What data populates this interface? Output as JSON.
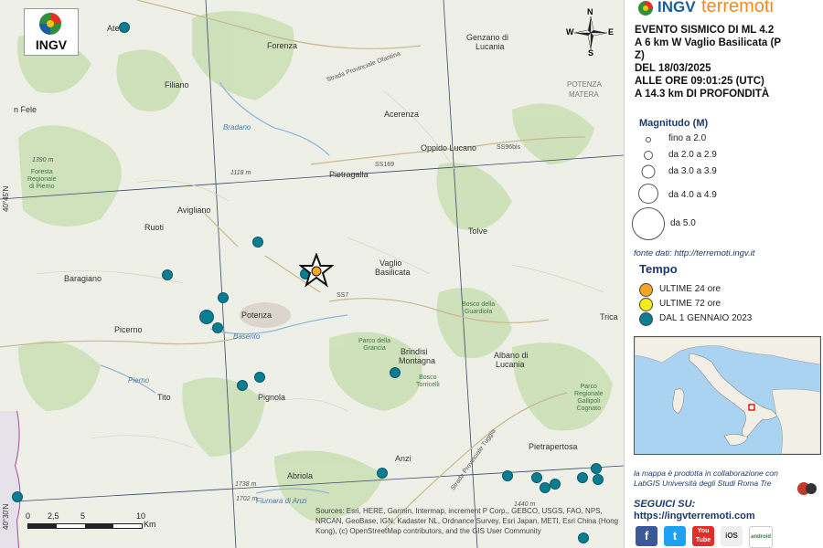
{
  "logo": {
    "label": "INGV"
  },
  "compass": {
    "n": "N",
    "s": "S",
    "e": "E",
    "w": "W"
  },
  "brand": {
    "prefix": "INGV",
    "suffix": "terremoti"
  },
  "event": {
    "line1": "EVENTO SISMICO DI ML 4.2",
    "line2": "A 6 km W Vaglio Basilicata (P",
    "line3": "Z)",
    "line4": "DEL 18/03/2025",
    "line5": "ALLE ORE 09:01:25 (UTC)",
    "line6": "A 14.3 km DI PROFONDITÀ"
  },
  "magnitude_legend": {
    "title": "Magnitudo (M)",
    "items": [
      "fino a 2.0",
      "da 2.0 a 2.9",
      "da 3.0 a 3.9",
      "da 4.0 a 4.9",
      "da 5.0"
    ]
  },
  "source": "fonte dati: http://terremoti.ingv.it",
  "time_legend": {
    "title": "Tempo",
    "items": [
      {
        "label": "ULTIME 24 ore",
        "color": "#f5a623"
      },
      {
        "label": "ULTIME 72 ore",
        "color": "#f5ec1e"
      },
      {
        "label": "DAL 1 GENNAIO 2023",
        "color": "#0b7d93"
      }
    ]
  },
  "collab": {
    "line1": "la mappa è prodotta in collaborazione con",
    "line2": "LabGIS Università degli Studi Roma Tre"
  },
  "follow": {
    "title": "SEGUICI SU:",
    "url": "https://ingvterremoti.com"
  },
  "social": {
    "facebook": "f",
    "twitter": "t",
    "youtube": "You Tube",
    "ios": "iOS",
    "android": "android"
  },
  "scale": {
    "ticks": [
      "0",
      "2,5",
      "5",
      "10"
    ],
    "unit": "Km"
  },
  "attribution": "Sources: Esri, HERE, Garmin, Intermap, increment P Corp., GEBCO, USGS, FAO, NPS, NRCAN, GeoBase, IGN, Kadaster NL, Ordnance Survey, Esri Japan, METI, Esri China (Hong Kong), (c) OpenStreetMap contributors, and the GIS User Community",
  "lat_labels": [
    "40°45'N",
    "40°30'N"
  ],
  "places": {
    "atella": "Atella",
    "forenza": "Forenza",
    "genzano": "Genzano di",
    "lucania": "Lucania",
    "filiano": "Filiano",
    "acerenza": "Acerenza",
    "oppido": "Oppido Lucano",
    "sanfele": "n Fele",
    "pietragalla": "Pietragalla",
    "avigliano": "Avigliano",
    "ruoti": "Ruoti",
    "tolve": "Tolve",
    "vaglio": "Vaglio",
    "basilicata": "Basilicata",
    "baragiano": "Baragiano",
    "potenza": "Potenza",
    "picerno": "Picerno",
    "brindisi": "Brindisi",
    "montagna": "Montagna",
    "albano": "Albano di",
    "albano2": "Lucania",
    "tito": "Tito",
    "pignola": "Pignola",
    "anzi": "Anzi",
    "pietrapertosa": "Pietrapertosa",
    "abriola": "Abriola",
    "potenza_label": "POTENZA",
    "matera_label": "MATERA",
    "trica": "Trica",
    "bradano": "Bradano",
    "basento": "Basento",
    "fiumara": "Fiumara di Anzi",
    "pierno": "Pierno"
  },
  "roads": {
    "ss96bis": "SS96bis",
    "ss169": "SS169",
    "ss7": "SS7",
    "sp": "Strada Provinciale Ofantina",
    "sp2": "Strada Provinciale Tuggia"
  },
  "greens": {
    "g1": "Foresta\nRegionale\ndi Pierno",
    "g2": "Parco della\nGrancia",
    "g3": "Bosco\nTorricelli",
    "g4": "Bosco della\nGuardiola",
    "g5": "Parco\nRegionale\nGallipoli\nCognato"
  },
  "elevations": {
    "e1": "1390 m",
    "e2": "1118 m",
    "e3": "1738 m",
    "e4": "1702 m",
    "e5": "1440 m"
  },
  "quakes": [
    {
      "id": "q1",
      "size": "small"
    },
    {
      "id": "q2",
      "size": "small"
    },
    {
      "id": "q3",
      "size": "small"
    },
    {
      "id": "q4",
      "size": "small"
    },
    {
      "id": "q5",
      "size": "large"
    },
    {
      "id": "q6",
      "size": "small"
    },
    {
      "id": "q7",
      "size": "small"
    },
    {
      "id": "q8",
      "size": "small"
    },
    {
      "id": "q9",
      "size": "small"
    },
    {
      "id": "q10",
      "size": "small"
    },
    {
      "id": "q11",
      "size": "small"
    },
    {
      "id": "q12",
      "size": "small"
    },
    {
      "id": "q13",
      "size": "small"
    },
    {
      "id": "q14",
      "size": "small"
    },
    {
      "id": "q15",
      "size": "small"
    },
    {
      "id": "q16",
      "size": "small"
    },
    {
      "id": "q17",
      "size": "small"
    },
    {
      "id": "q18",
      "size": "small"
    },
    {
      "id": "q19",
      "size": "small"
    },
    {
      "id": "q20",
      "size": "small"
    }
  ],
  "epicenter": {
    "marker": "star",
    "color": "#f5a623"
  },
  "colors": {
    "quake": "#0b7d93",
    "epicenter": "#f5a623",
    "brand_orange": "#f08a1c",
    "brand_blue": "#1b5e9e"
  }
}
